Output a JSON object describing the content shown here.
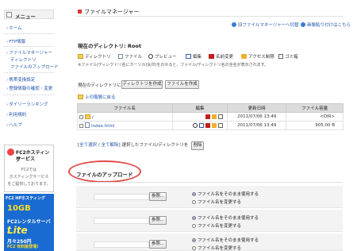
{
  "sidebar": {
    "menu_title": "メニュー",
    "items": [
      {
        "label": "ホーム"
      },
      {
        "label": "FTP情報"
      },
      {
        "label": "ファイルマネージャー"
      },
      {
        "label": "ディレクトリ"
      },
      {
        "label": "ファイルのアップロード"
      },
      {
        "label": "携帯変換設定"
      },
      {
        "label": "登録情報の確認・変更"
      },
      {
        "label": "ダイリーランキング"
      },
      {
        "label": "利用規約"
      },
      {
        "label": "ヘルプ"
      }
    ],
    "ad": {
      "title1": "FC2ホスティング",
      "title2": "サービス",
      "line1": "FC2では",
      "line2": "ホスティングサービス",
      "line3": "をご提供しております。"
    },
    "banner": {
      "line1": "FC2 HPホスティング",
      "big1": "10GB",
      "line2": "FC2レンタルサーバー",
      "big2": "Lite",
      "line3": "月々250円",
      "line4": "FC2 有料版登場!"
    }
  },
  "main": {
    "title": "ファイルマネージャー",
    "links": {
      "old_manager": "旧ファイルマネージャーへ切替",
      "image_link": "画像貼り付けはこちら"
    },
    "current_dir": "現在のディレクトリ: Root",
    "legend": [
      "ディレクトリ",
      "ファイル",
      "プレビュー",
      "編集",
      "名前変更",
      "アクセス制限",
      "ゴミ箱"
    ],
    "note": "※ファイル/ディレクトリ名にカーソル(矢印)をのせると、ファイル/ディレクトリ名の全名が表示されます。",
    "create_label": "現在のディレクトリに",
    "create_dir_btn": "ディレクトリを作成",
    "create_file_btn": "ファイルを作成",
    "up_link": "上の階層に戻る",
    "table": {
      "headers": [
        "ファイル名",
        "編集",
        "更新日時",
        "ファイル容量"
      ],
      "rows": [
        {
          "name": "/",
          "date": "2011/07/06 13:49",
          "size": "<DIR>"
        },
        {
          "name": "index.html",
          "date": "2011/07/06 13:49",
          "size": "905.00 B"
        }
      ]
    },
    "select_all": "全て選択",
    "deselect_all": "全て解除",
    "selected_label": "選択したファイル/ディレクトリを",
    "delete_btn": "削除",
    "upload_title": "ファイルのアップロード",
    "upload": {
      "browse_btn": "参照...",
      "opt_keep": "ファイル名をそのまま使用する",
      "opt_change": "ファイル名を変更する"
    }
  },
  "colors": {
    "accent_red": "#d33333",
    "link_blue": "#2255aa",
    "header_gray": "#dcdcdc"
  }
}
